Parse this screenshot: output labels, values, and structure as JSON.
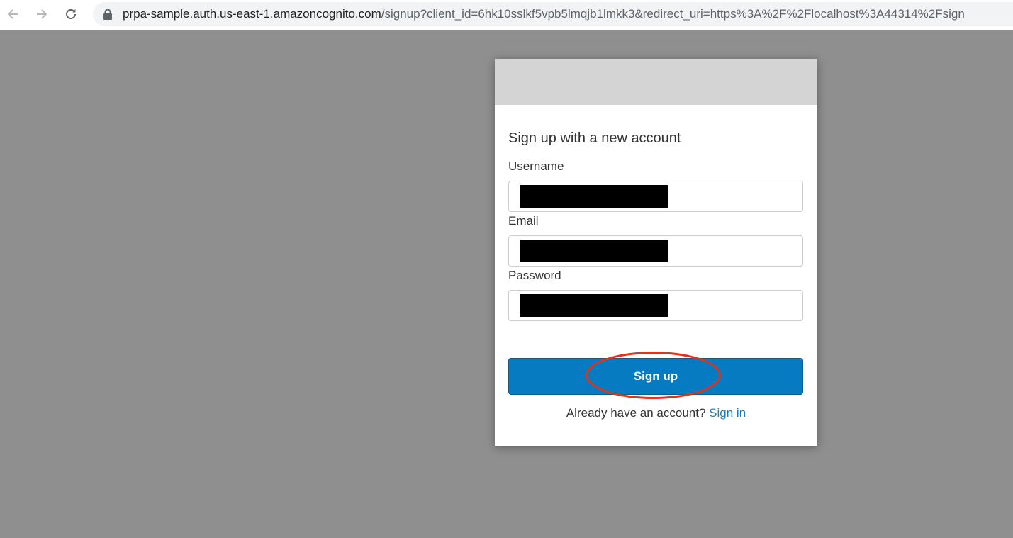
{
  "browser": {
    "url_host": "prpa-sample.auth.us-east-1.amazoncognito.com",
    "url_path": "/signup?client_id=6hk10sslkf5vpb5lmqjb1lmkk3&redirect_uri=https%3A%2F%2Flocalhost%3A44314%2Fsign",
    "icons": [
      "back-arrow-icon",
      "forward-arrow-icon",
      "reload-icon",
      "lock-icon"
    ]
  },
  "form": {
    "title": "Sign up with a new account",
    "username_label": "Username",
    "email_label": "Email",
    "password_label": "Password",
    "signup_button": "Sign up",
    "signin_prompt": "Already have an account?",
    "signin_link": "Sign in"
  },
  "colors": {
    "page_background": "#8f8f8f",
    "banner": "#d4d4d4",
    "button": "#077bc1",
    "link": "#1a7ec4",
    "highlight": "#e2321a"
  }
}
